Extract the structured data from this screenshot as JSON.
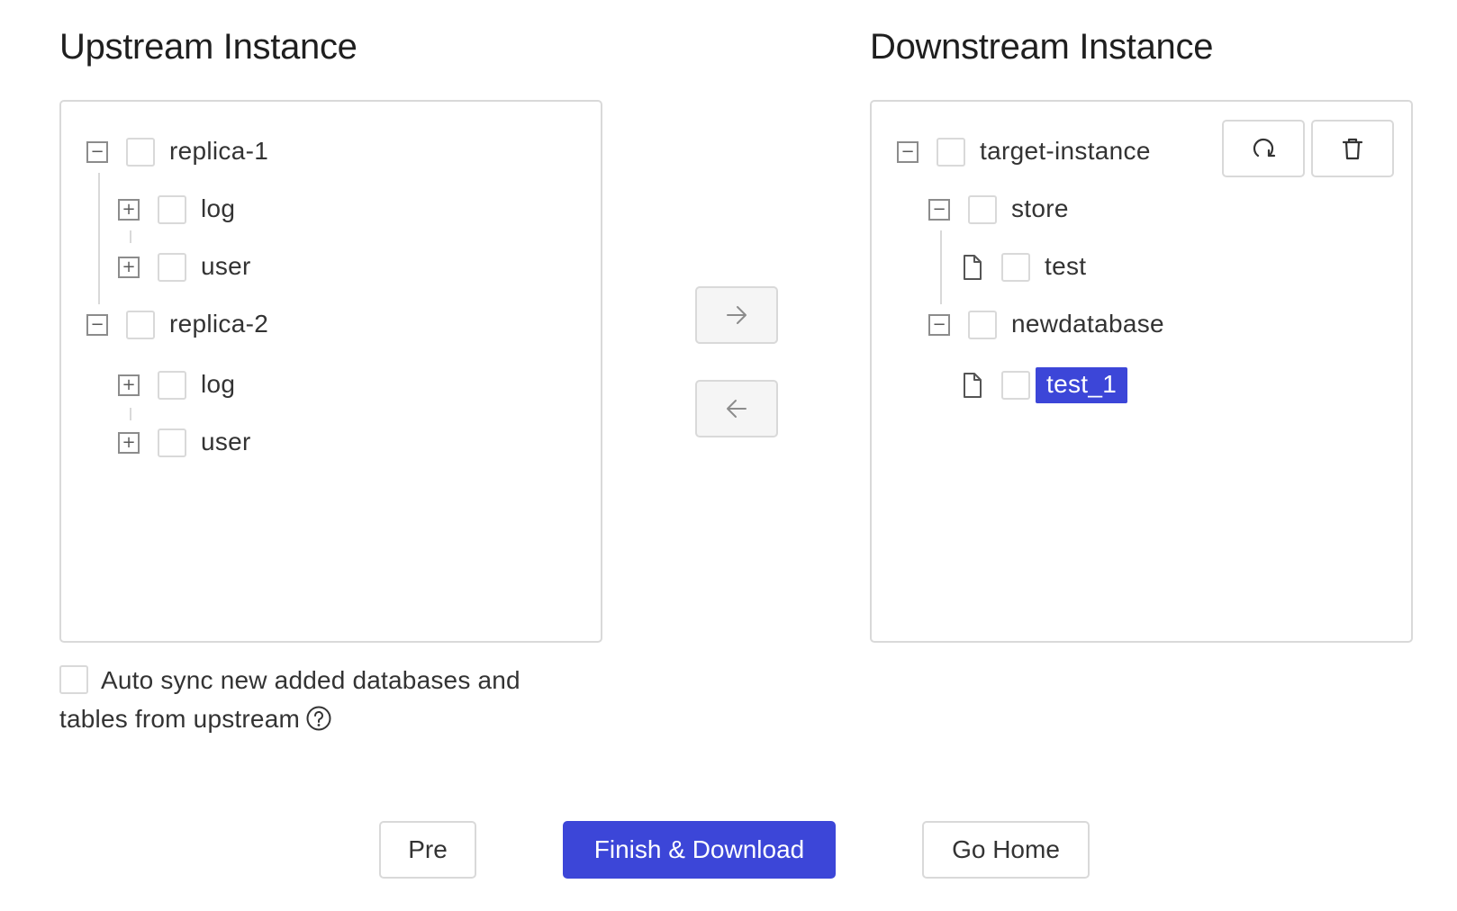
{
  "upstream": {
    "title": "Upstream Instance",
    "nodes": [
      {
        "label": "replica-1",
        "children": [
          {
            "label": "log"
          },
          {
            "label": "user"
          }
        ]
      },
      {
        "label": "replica-2",
        "children": [
          {
            "label": "log"
          },
          {
            "label": "user"
          }
        ]
      }
    ]
  },
  "downstream": {
    "title": "Downstream Instance",
    "root": "target-instance",
    "databases": [
      {
        "label": "store",
        "tables": [
          {
            "label": "test"
          }
        ]
      },
      {
        "label": "newdatabase",
        "tables": [
          {
            "label": "test_1",
            "selected": true
          }
        ]
      }
    ],
    "refresh_icon": "refresh-icon",
    "delete_icon": "trash-icon"
  },
  "transfer": {
    "right_icon": "arrow-right-icon",
    "left_icon": "arrow-left-icon"
  },
  "auto_sync": {
    "label": "Auto sync new added databases and tables from upstream",
    "help_icon": "help-icon"
  },
  "footer": {
    "pre_label": "Pre",
    "finish_label": "Finish & Download",
    "home_label": "Go Home"
  },
  "colors": {
    "primary": "#3c46d8",
    "border": "#d9d9d9"
  }
}
